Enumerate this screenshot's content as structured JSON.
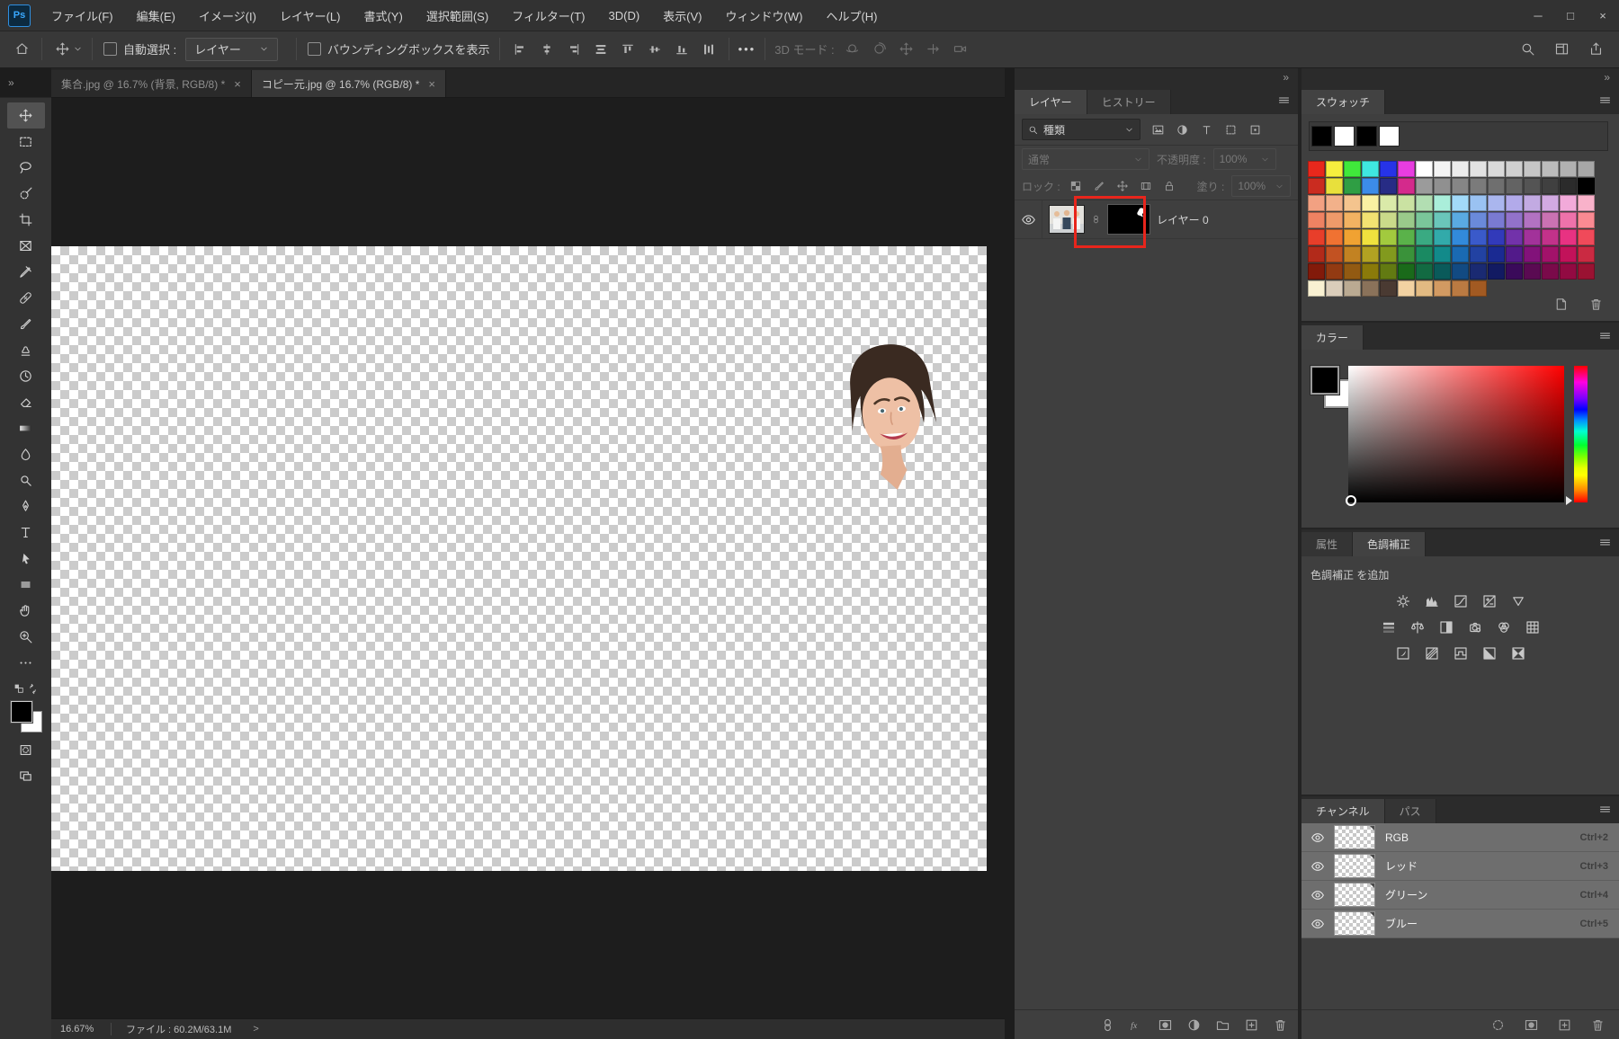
{
  "window": {
    "logo_text": "Ps",
    "controls": [
      {
        "name": "minimize-button",
        "glyph": "─"
      },
      {
        "name": "maximize-button",
        "glyph": "□"
      },
      {
        "name": "close-button",
        "glyph": "×"
      }
    ]
  },
  "menu_bar": {
    "items": [
      {
        "id": "file",
        "label": "ファイル(F)"
      },
      {
        "id": "edit",
        "label": "編集(E)"
      },
      {
        "id": "image",
        "label": "イメージ(I)"
      },
      {
        "id": "layer",
        "label": "レイヤー(L)"
      },
      {
        "id": "type",
        "label": "書式(Y)"
      },
      {
        "id": "select",
        "label": "選択範囲(S)"
      },
      {
        "id": "filter",
        "label": "フィルター(T)"
      },
      {
        "id": "3d",
        "label": "3D(D)"
      },
      {
        "id": "view",
        "label": "表示(V)"
      },
      {
        "id": "window",
        "label": "ウィンドウ(W)"
      },
      {
        "id": "help",
        "label": "ヘルプ(H)"
      }
    ]
  },
  "options_bar": {
    "auto_select_label": "自動選択 :",
    "auto_select_checked": false,
    "auto_select_value": "レイヤー",
    "bbox_label": "バウンディングボックスを表示",
    "bbox_checked": false,
    "more_label": "•••",
    "mode_3d_label": "3D モード :",
    "align_icons": [
      {
        "name": "align-left-edges-button",
        "icon": "al"
      },
      {
        "name": "align-horizontal-centers-button",
        "icon": "ach"
      },
      {
        "name": "align-right-edges-button",
        "icon": "ar"
      },
      {
        "name": "distribute-vertical-centers-button",
        "icon": "dvc"
      },
      {
        "name": "align-top-edges-button",
        "icon": "at"
      },
      {
        "name": "align-vertical-centers-button",
        "icon": "avc"
      },
      {
        "name": "align-bottom-edges-button",
        "icon": "ab"
      },
      {
        "name": "distribute-horizontal-centers-button",
        "icon": "dhc"
      }
    ],
    "mode_3d_icons": [
      {
        "name": "3d-orbit-button",
        "icon": "orbit"
      },
      {
        "name": "3d-roll-button",
        "icon": "roll"
      },
      {
        "name": "3d-pan-button",
        "icon": "move"
      },
      {
        "name": "3d-slide-button",
        "icon": "slide"
      },
      {
        "name": "3d-camera-button",
        "icon": "cam"
      }
    ],
    "right_icons": [
      {
        "name": "search-icon",
        "icon": "search"
      },
      {
        "name": "workspace-switcher-icon",
        "icon": "workspace"
      },
      {
        "name": "share-icon",
        "icon": "share"
      }
    ]
  },
  "document_tabs": [
    {
      "name": "doc-tab-shugo",
      "label": "集合.jpg @ 16.7% (背景, RGB/8) *",
      "close": "×",
      "active": false
    },
    {
      "name": "doc-tab-copymoto",
      "label": "コピー元.jpg @ 16.7% (RGB/8) *",
      "close": "×",
      "active": true
    }
  ],
  "toolbar": {
    "collapse_glyph": "»",
    "foreground_color": "#000000",
    "background_color": "#ffffff",
    "tools": [
      {
        "name": "move-tool",
        "icon": "move",
        "selected": true
      },
      {
        "name": "marquee-tool",
        "icon": "marquee",
        "selected": false
      },
      {
        "name": "lasso-tool",
        "icon": "lasso",
        "selected": false
      },
      {
        "name": "quick-selection-tool",
        "icon": "quickselect",
        "selected": false
      },
      {
        "name": "crop-tool",
        "icon": "crop",
        "selected": false
      },
      {
        "name": "frame-tool",
        "icon": "frame",
        "selected": false
      },
      {
        "name": "eyedropper-tool",
        "icon": "eyedropper",
        "selected": false
      },
      {
        "name": "healing-brush-tool",
        "icon": "healing",
        "selected": false
      },
      {
        "name": "brush-tool",
        "icon": "brush",
        "selected": false
      },
      {
        "name": "clone-stamp-tool",
        "icon": "stamp",
        "selected": false
      },
      {
        "name": "history-brush-tool",
        "icon": "historybrush",
        "selected": false
      },
      {
        "name": "eraser-tool",
        "icon": "eraser",
        "selected": false
      },
      {
        "name": "gradient-tool",
        "icon": "gradienttool",
        "selected": false
      },
      {
        "name": "blur-tool",
        "icon": "blur",
        "selected": false
      },
      {
        "name": "dodge-tool",
        "icon": "dodge",
        "selected": false
      },
      {
        "name": "pen-tool",
        "icon": "pen",
        "selected": false
      },
      {
        "name": "type-tool",
        "icon": "typetool",
        "selected": false
      },
      {
        "name": "path-selection-tool",
        "icon": "pathselect",
        "selected": false
      },
      {
        "name": "rectangle-tool",
        "icon": "rectshape",
        "selected": false
      },
      {
        "name": "hand-tool",
        "icon": "hand",
        "selected": false
      },
      {
        "name": "zoom-tool",
        "icon": "zoom",
        "selected": false
      },
      {
        "name": "edit-toolbar-button",
        "icon": "ellipsis",
        "selected": false
      }
    ]
  },
  "canvas": {
    "photo_description": "woman's face with dark hair on transparent checkerboard"
  },
  "layers_panel": {
    "collapse_glyph": "»",
    "tabs": [
      {
        "label": "レイヤー"
      },
      {
        "label": "ヒストリー"
      }
    ],
    "search_label": "種類",
    "filter_icons": [
      {
        "name": "filter-image-icon",
        "icon": "imgfilter"
      },
      {
        "name": "filter-adjustment-icon",
        "icon": "adjfilter"
      },
      {
        "name": "filter-type-icon",
        "icon": "typefilter"
      },
      {
        "name": "filter-shape-icon",
        "icon": "shapefilter"
      },
      {
        "name": "filter-smart-object-icon",
        "icon": "smartfilter"
      }
    ],
    "blend_mode": "通常",
    "opacity_label": "不透明度 :",
    "opacity_value": "100%",
    "lock_label": "ロック :",
    "lock_icons": [
      {
        "name": "lock-transparency-icon",
        "icon": "lockcheck"
      },
      {
        "name": "lock-pixels-icon",
        "icon": "lockbrush"
      },
      {
        "name": "lock-position-icon",
        "icon": "move"
      },
      {
        "name": "lock-artboard-icon",
        "icon": "lockframe"
      },
      {
        "name": "lock-all-icon",
        "icon": "lock"
      }
    ],
    "fill_label": "塗り :",
    "fill_value": "100%",
    "layers": [
      {
        "name": "レイヤー 0",
        "visible": true,
        "has_mask": true
      }
    ],
    "bottom_icons": [
      {
        "name": "link-layers-button",
        "icon": "chain"
      },
      {
        "name": "layer-effects-button",
        "icon": "fx"
      },
      {
        "name": "add-layer-mask-button",
        "icon": "addmask"
      },
      {
        "name": "new-adjustment-layer-button",
        "icon": "adjfilter"
      },
      {
        "name": "new-group-button",
        "icon": "folder"
      },
      {
        "name": "new-layer-button",
        "icon": "newlayer"
      },
      {
        "name": "delete-layer-button",
        "icon": "trash"
      }
    ]
  },
  "annotation": {
    "highlight_color": "#e8251c",
    "highlighted_element": "layer-mask-thumbnail"
  },
  "swatches_panel": {
    "tab": "スウォッチ",
    "recent": [
      "#000000",
      "#ffffff",
      "#000000",
      "#ffffff"
    ],
    "rows": [
      [
        "#e8281c",
        "#f6ee3e",
        "#40e83b",
        "#3fe8e0",
        "#2633e8",
        "#e83de0",
        "#ffffff",
        "#f4f4f4",
        "#ececec",
        "#e3e3e3",
        "#dadada",
        "#d0d0d0",
        "#c6c6c6",
        "#bcbcbc",
        "#b1b1b1",
        "#a7a7a7"
      ],
      [
        "#ca2c20",
        "#e8e03c",
        "#2f9e44",
        "#3c8ce8",
        "#272c85",
        "#d42a8c",
        "#9b9b9b",
        "#909090",
        "#868686",
        "#7b7b7b",
        "#6f6f6f",
        "#636363",
        "#545454",
        "#404040",
        "#2b2b2b",
        "#000000"
      ],
      [
        "#f2a182",
        "#f2b18a",
        "#f4c48e",
        "#f9f1a2",
        "#daeaa9",
        "#cae2a2",
        "#b2deb2",
        "#aaeeda",
        "#a2daf9",
        "#9ac2f2",
        "#aab6ee",
        "#b2aaea",
        "#c2aae2",
        "#d2aae2",
        "#f2aada",
        "#f9b2ca"
      ],
      [
        "#ee8262",
        "#ee9a6a",
        "#f2b262",
        "#f2e272",
        "#cada8a",
        "#9aca8a",
        "#7ac69a",
        "#6ac6ba",
        "#5aaae2",
        "#6a8ada",
        "#7a7ad2",
        "#9272ca",
        "#b272c2",
        "#ca72b2",
        "#ee72aa",
        "#fa8a92"
      ],
      [
        "#e83e2a",
        "#f07232",
        "#f0a232",
        "#f0e23e",
        "#a2ca3e",
        "#5ab24a",
        "#3aaa82",
        "#32aaaa",
        "#328ada",
        "#3a5aca",
        "#323aba",
        "#7232aa",
        "#a2329a",
        "#c2328a",
        "#e83282",
        "#f04a5a"
      ],
      [
        "#b22a1a",
        "#c25222",
        "#c28222",
        "#b2a222",
        "#829a1e",
        "#3a923a",
        "#1a8a62",
        "#128a8a",
        "#1a6ab2",
        "#2242a2",
        "#1a2a92",
        "#521a8a",
        "#82127a",
        "#a2126a",
        "#c2125a",
        "#ca2a42"
      ],
      [
        "#821a0a",
        "#923a12",
        "#925a12",
        "#8a7a0a",
        "#627a12",
        "#1a6a1a",
        "#126a42",
        "#0a5a5a",
        "#124a82",
        "#1a2a72",
        "#121a62",
        "#3a0a5a",
        "#5a0a52",
        "#7a0a4a",
        "#920a42",
        "#9a1232"
      ],
      [
        "#f9f1d2",
        "#dacdba",
        "#baaa92",
        "#8a725a",
        "#4a3a32",
        "#f2d2a2",
        "#e2ba82",
        "#d29a62",
        "#ba7a42",
        "#a25a22"
      ]
    ],
    "bottom_icons": [
      {
        "name": "new-swatch-button",
        "icon": "newswatch"
      },
      {
        "name": "delete-swatch-button",
        "icon": "trash"
      }
    ]
  },
  "color_panel": {
    "tab": "カラー",
    "foreground_color": "#000000",
    "background_color": "#ffffff",
    "hue": "red"
  },
  "adjustments_panel": {
    "tabs": [
      {
        "label": "属性"
      },
      {
        "label": "色調補正"
      }
    ],
    "header": "色調補正 を追加",
    "rows": [
      [
        {
          "name": "brightness-contrast-icon",
          "icon": "sun"
        },
        {
          "name": "levels-icon",
          "icon": "levels"
        },
        {
          "name": "curves-icon",
          "icon": "curves"
        },
        {
          "name": "exposure-icon",
          "icon": "exposure"
        },
        {
          "name": "vibrance-icon",
          "icon": "vibrance"
        }
      ],
      [
        {
          "name": "hue-saturation-icon",
          "icon": "huesat"
        },
        {
          "name": "color-balance-icon",
          "icon": "colorbalance"
        },
        {
          "name": "black-white-icon",
          "icon": "bw"
        },
        {
          "name": "photo-filter-icon",
          "icon": "photofilter"
        },
        {
          "name": "channel-mixer-icon",
          "icon": "channelmixer"
        },
        {
          "name": "color-lookup-icon",
          "icon": "colorlookup"
        }
      ],
      [
        {
          "name": "invert-icon",
          "icon": "invert"
        },
        {
          "name": "posterize-icon",
          "icon": "posterize"
        },
        {
          "name": "threshold-icon",
          "icon": "threshold"
        },
        {
          "name": "gradient-map-icon",
          "icon": "gradmap"
        },
        {
          "name": "selective-color-icon",
          "icon": "selcolor"
        }
      ]
    ]
  },
  "channels_panel": {
    "tabs": [
      {
        "label": "チャンネル"
      },
      {
        "label": "パス"
      }
    ],
    "channels": [
      {
        "name": "RGB",
        "shortcut": "Ctrl+2",
        "visible": true
      },
      {
        "name": "レッド",
        "shortcut": "Ctrl+3",
        "visible": true
      },
      {
        "name": "グリーン",
        "shortcut": "Ctrl+4",
        "visible": true
      },
      {
        "name": "ブルー",
        "shortcut": "Ctrl+5",
        "visible": true
      }
    ],
    "bottom_icons": [
      {
        "name": "load-selection-button",
        "icon": "loadsel"
      },
      {
        "name": "save-selection-as-channel-button",
        "icon": "addmask"
      },
      {
        "name": "new-channel-button",
        "icon": "newlayer"
      },
      {
        "name": "delete-channel-button",
        "icon": "trash"
      }
    ]
  },
  "status_bar": {
    "zoom": "16.67%",
    "file_info": "ファイル : 60.2M/63.1M",
    "chevron": ">"
  }
}
